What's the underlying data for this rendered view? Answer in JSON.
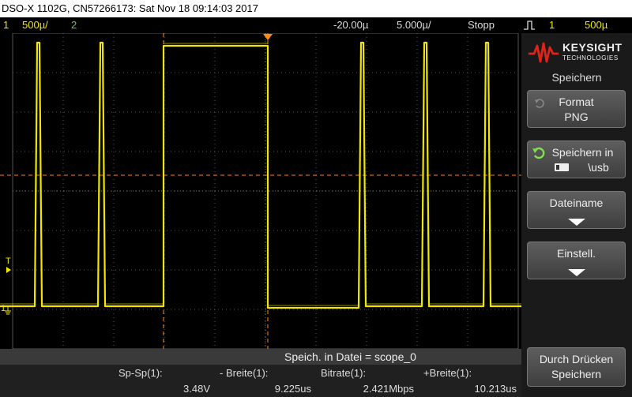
{
  "titlebar": {
    "text": "DSO-X 1102G, CN57266173: Sat Nov 18 09:14:03 2017"
  },
  "status": {
    "ch1_num": "1",
    "ch1_scale": "500µ/",
    "ch2_num": "2",
    "time_offset": "-20.00µ",
    "time_scale": "5.000µ/",
    "run_state": "Stopp",
    "trigger_ch": "1",
    "trigger_level": "500µ"
  },
  "screen": {
    "trigger_marker_label": "T",
    "ch1_ground_label": "1"
  },
  "message": {
    "text": "Speich. in Datei = scope_0"
  },
  "measurements": [
    {
      "label": "Sp-Sp(1):",
      "value": "3.48V"
    },
    {
      "label": "- Breite(1):",
      "value": "9.225us"
    },
    {
      "label": "Bitrate(1):",
      "value": "2.421Mbps"
    },
    {
      "label": "+Breite(1):",
      "value": "10.213us"
    }
  ],
  "sidepanel": {
    "brand": "KEYSIGHT",
    "brand_sub": "TECHNOLOGIES",
    "menu_title": "Speichern",
    "buttons": [
      {
        "line1": "Format",
        "line2": "PNG"
      },
      {
        "line1": "Speichern in",
        "line2": "\\usb"
      },
      {
        "line1": "Dateiname",
        "line2": ""
      },
      {
        "line1": "Einstell.",
        "line2": ""
      },
      {
        "line1": "Durch Drücken",
        "line2": "Speichern"
      }
    ]
  },
  "colors": {
    "channel1": "#f2e600",
    "channel2": "#4cd24c",
    "cursor": "#ff8c1a",
    "accent": "#e2231a"
  }
}
